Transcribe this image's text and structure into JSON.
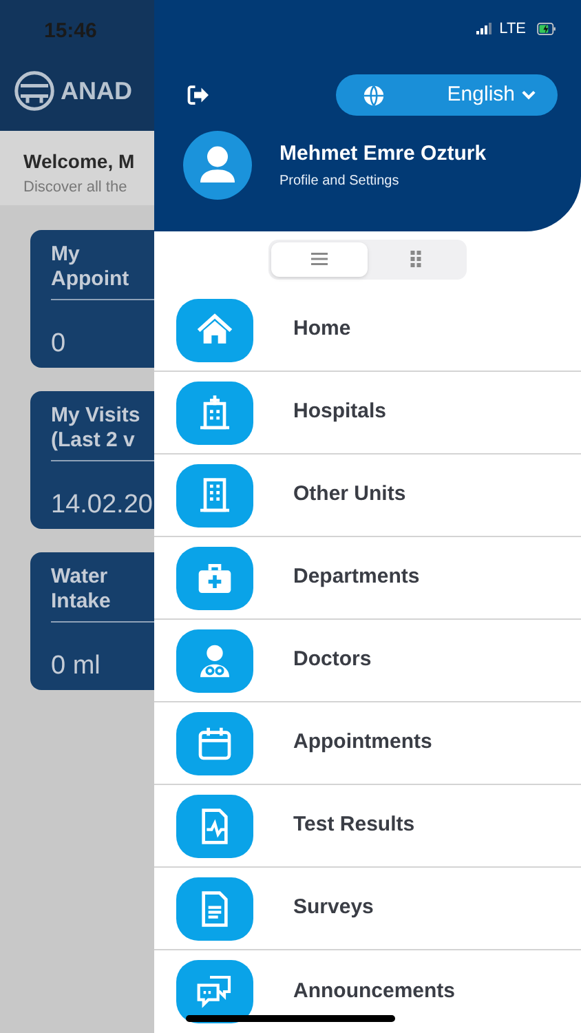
{
  "status_bar": {
    "time": "15:46",
    "network": "LTE"
  },
  "background": {
    "brand": "ANAD",
    "welcome": {
      "title": "Welcome, M",
      "subtitle": "Discover all the"
    },
    "cards": [
      {
        "title": "My Appoint",
        "value": "0"
      },
      {
        "title": "My Visits (Last 2 v",
        "value": "14.02.20"
      },
      {
        "title": "Water Intake",
        "value": "0 ml"
      }
    ]
  },
  "drawer": {
    "language": "English",
    "user": {
      "name": "Mehmet Emre Ozturk",
      "subtitle": "Profile and Settings"
    },
    "view_toggle": [
      {
        "kind": "list",
        "selected": true
      },
      {
        "kind": "grid",
        "selected": false
      }
    ],
    "menu": [
      {
        "kind": "home",
        "label": "Home"
      },
      {
        "kind": "hospital",
        "label": "Hospitals"
      },
      {
        "kind": "units",
        "label": "Other Units"
      },
      {
        "kind": "departments",
        "label": "Departments"
      },
      {
        "kind": "doctor",
        "label": "Doctors"
      },
      {
        "kind": "calendar",
        "label": "Appointments"
      },
      {
        "kind": "results",
        "label": "Test Results"
      },
      {
        "kind": "survey",
        "label": "Surveys"
      },
      {
        "kind": "chat",
        "label": "Announcements"
      }
    ]
  }
}
